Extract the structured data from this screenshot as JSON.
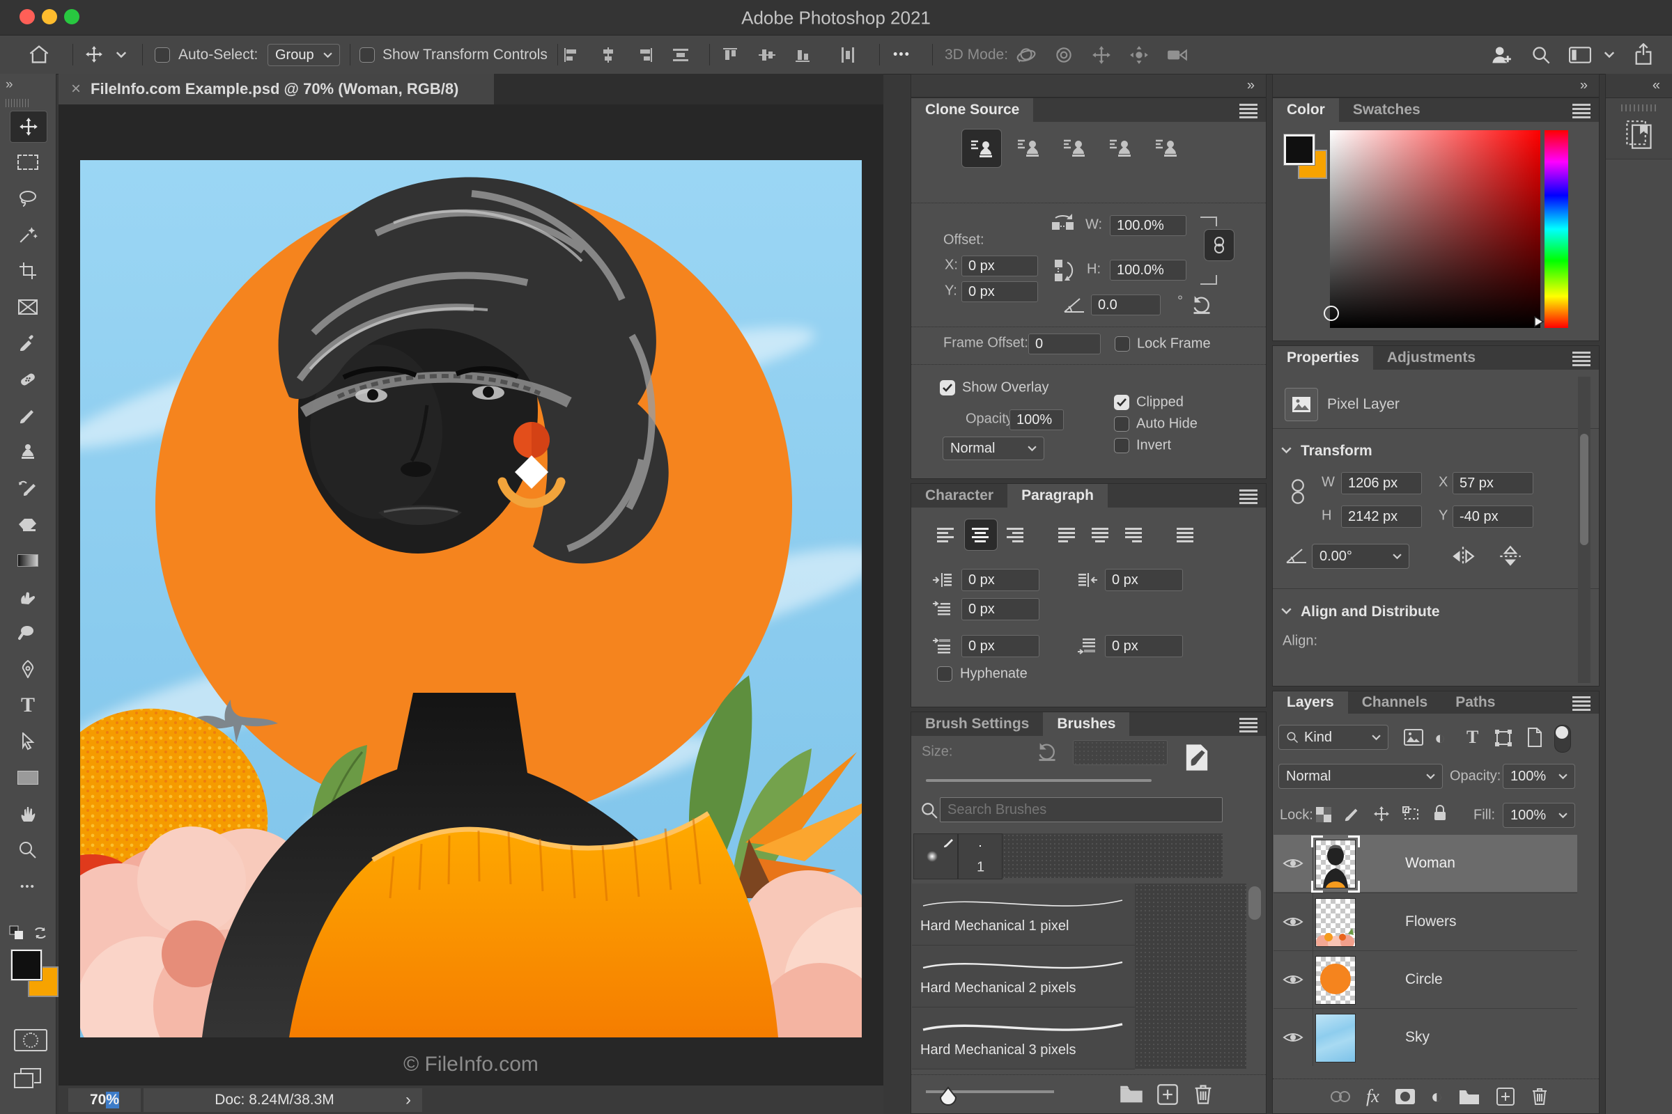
{
  "window": {
    "title": "Adobe Photoshop 2021"
  },
  "glyphs": {
    "double_chevron_right": "»",
    "double_chevron_left": "«",
    "close": "×",
    "dots_h": "•••",
    "chevron_right": "›",
    "degree": "°",
    "type_T": "T",
    "adjustment_circle": "◐"
  },
  "options_bar": {
    "auto_select_label": "Auto-Select:",
    "auto_select_value": "Group",
    "show_transform_label": "Show Transform Controls",
    "mode_3d_label": "3D Mode:"
  },
  "document": {
    "tab_title": "FileInfo.com Example.psd @ 70% (Woman, RGB/8)",
    "watermark": "© FileInfo.com",
    "status": {
      "zoom_number": "70",
      "zoom_percent": "%",
      "doc_size": "Doc: 8.24M/38.3M"
    }
  },
  "clone_source": {
    "title": "Clone Source",
    "offset_label": "Offset:",
    "x_label": "X:",
    "x_value": "0 px",
    "y_label": "Y:",
    "y_value": "0 px",
    "w_label": "W:",
    "w_value": "100.0%",
    "h_label": "H:",
    "h_value": "100.0%",
    "angle_value": "0.0",
    "frame_offset_label": "Frame Offset:",
    "frame_offset_value": "0",
    "lock_frame_label": "Lock Frame",
    "show_overlay_label": "Show Overlay",
    "opacity_label": "Opacity:",
    "opacity_value": "100%",
    "overlay_blend_mode": "Normal",
    "clipped_label": "Clipped",
    "auto_hide_label": "Auto Hide",
    "invert_label": "Invert"
  },
  "type_panels": {
    "character_tab": "Character",
    "paragraph_tab": "Paragraph",
    "indent_left": "0 px",
    "indent_right": "0 px",
    "indent_first_line": "0 px",
    "space_before": "0 px",
    "space_after": "0 px",
    "hyphenate_label": "Hyphenate"
  },
  "brushes": {
    "settings_tab": "Brush Settings",
    "brushes_tab": "Brushes",
    "size_label": "Size:",
    "search_placeholder": "Search Brushes",
    "preset_number": "1",
    "items": [
      {
        "name": "Hard Mechanical 1 pixel"
      },
      {
        "name": "Hard Mechanical 2 pixels"
      },
      {
        "name": "Hard Mechanical 3 pixels"
      }
    ]
  },
  "color_panel": {
    "color_tab": "Color",
    "swatches_tab": "Swatches",
    "foreground": "#101010",
    "background": "#f7a300"
  },
  "properties": {
    "properties_tab": "Properties",
    "adjustments_tab": "Adjustments",
    "layer_type": "Pixel Layer",
    "transform_label": "Transform",
    "w_label": "W",
    "w_value": "1206 px",
    "x_label": "X",
    "x_value": "57 px",
    "h_label": "H",
    "h_value": "2142 px",
    "y_label": "Y",
    "y_value": "-40 px",
    "angle_value": "0.00°",
    "align_distribute_label": "Align and Distribute",
    "align_label": "Align:"
  },
  "layers": {
    "layers_tab": "Layers",
    "channels_tab": "Channels",
    "paths_tab": "Paths",
    "kind_label": "Kind",
    "blend_mode": "Normal",
    "opacity_label": "Opacity:",
    "opacity_value": "100%",
    "lock_label": "Lock:",
    "fill_label": "Fill:",
    "fill_value": "100%",
    "fx_label": "fx",
    "rows": [
      {
        "name": "Woman",
        "selected": true
      },
      {
        "name": "Flowers",
        "selected": false
      },
      {
        "name": "Circle",
        "selected": false
      },
      {
        "name": "Sky",
        "selected": false
      }
    ]
  },
  "colors": {
    "accent_orange": "#f5841e",
    "sky_blue": "#8ecdee",
    "selection_blue": "#3d7cc9",
    "traffic_red": "#ff5f57",
    "traffic_yellow": "#febc2e",
    "traffic_green": "#28c840"
  }
}
